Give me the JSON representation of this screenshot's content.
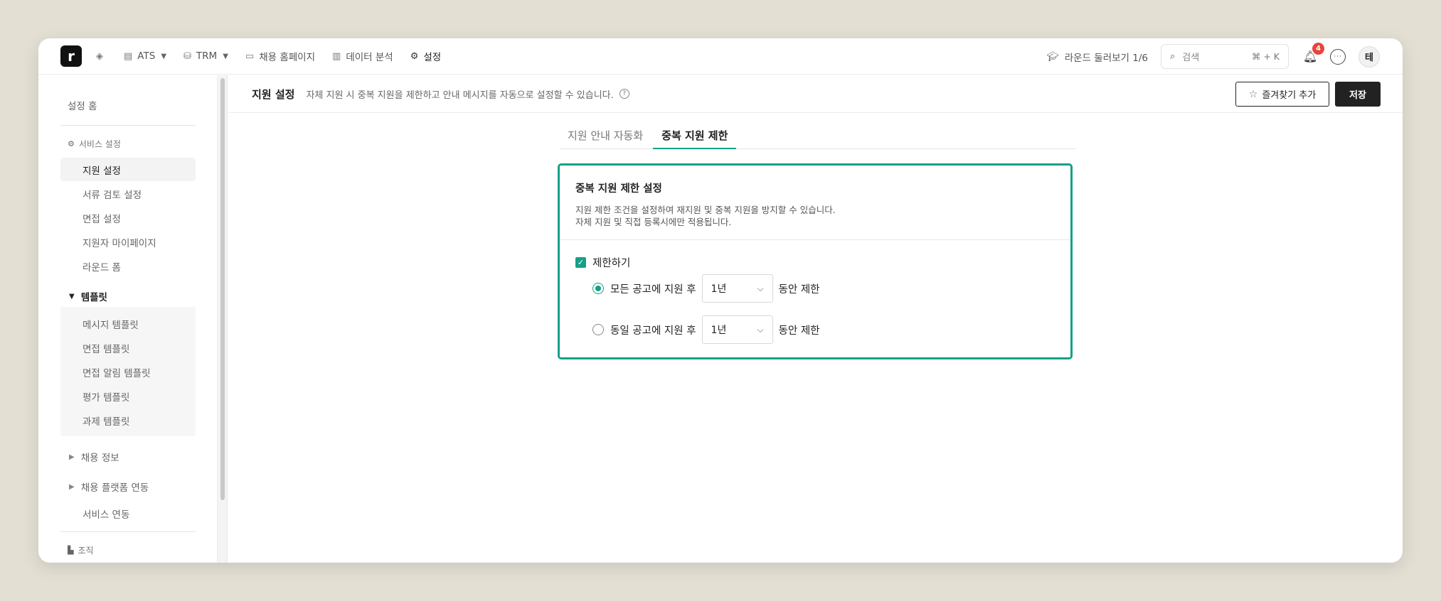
{
  "nav": {
    "items": [
      {
        "label": "ATS",
        "icon": "database-icon",
        "caret": true
      },
      {
        "label": "TRM",
        "icon": "database-icon",
        "caret": true
      },
      {
        "label": "채용 홈페이지",
        "icon": "browser-icon"
      },
      {
        "label": "데이터 분석",
        "icon": "chart-icon"
      },
      {
        "label": "설정",
        "icon": "gear-icon",
        "active": true
      }
    ],
    "tour_label": "라운드 둘러보기 1/6",
    "search_placeholder": "검색",
    "search_shortcut": "⌘ + K",
    "notification_count": "4",
    "avatar_initial": "테"
  },
  "sidebar": {
    "home": "설정 홈",
    "service_section": "서비스 설정",
    "service_items": [
      "지원 설정",
      "서류 검토 설정",
      "면접 설정",
      "지원자 마이페이지",
      "라운드 폼"
    ],
    "template_group": "템플릿",
    "template_items": [
      "메시지 템플릿",
      "면접 템플릿",
      "면접 알림 템플릿",
      "평가 템플릿",
      "과제 템플릿"
    ],
    "recruit_info": "채용 정보",
    "platform_link": "채용 플랫폼 연동",
    "service_link": "서비스 연동",
    "org_section": "조직"
  },
  "header": {
    "title": "지원 설정",
    "description": "자체 지원 시 중복 지원을 제한하고 안내 메시지를 자동으로 설정할 수 있습니다.",
    "fav_button": "즐겨찾기 추가",
    "save_button": "저장"
  },
  "tabs": [
    "지원 안내 자동화",
    "중복 지원 제한"
  ],
  "card": {
    "title": "중복 지원 제한 설정",
    "desc_line1": "지원 제한 조건을 설정하여 재지원 및 중복 지원을 방지할 수 있습니다.",
    "desc_line2": "자체 지원 및 직접 등록시에만 적용됩니다.",
    "checkbox_label": "제한하기",
    "options": [
      {
        "prefix": "모든 공고에 지원 후",
        "value": "1년",
        "suffix": "동안 제한",
        "selected": true
      },
      {
        "prefix": "동일 공고에 지원 후",
        "value": "1년",
        "suffix": "동안 제한",
        "selected": false
      }
    ]
  },
  "colors": {
    "accent": "#16a087",
    "badge": "#e8453c"
  }
}
